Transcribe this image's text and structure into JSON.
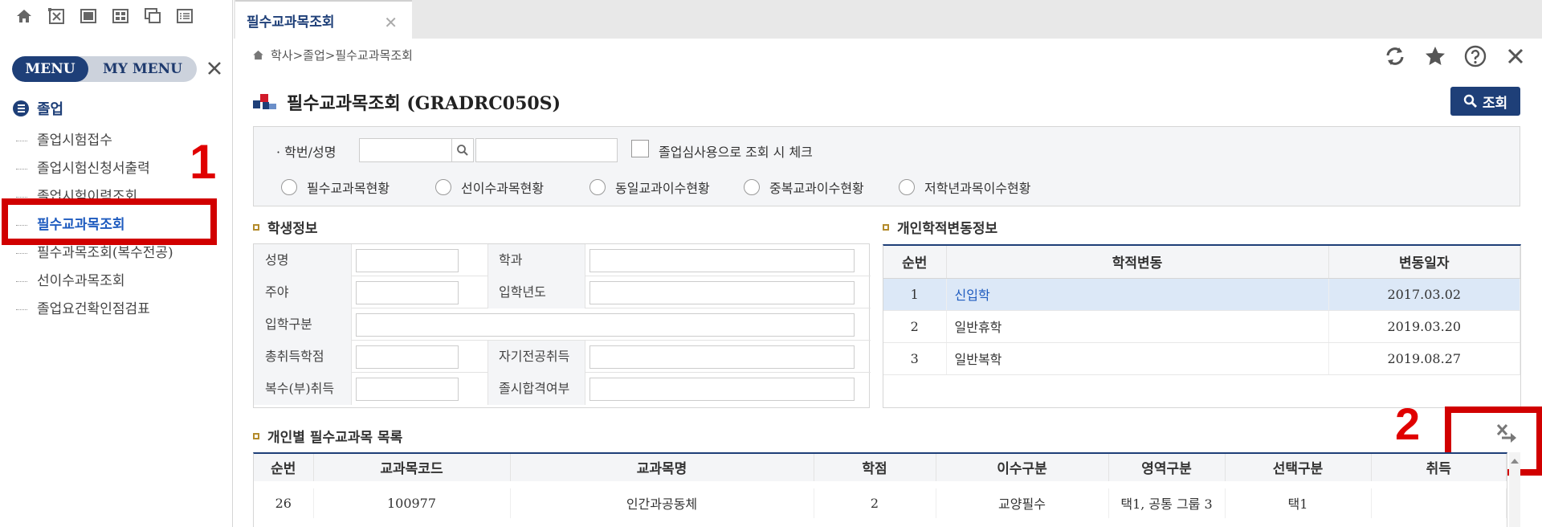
{
  "sidebar": {
    "toolbar_icons": [
      "home-icon",
      "close-window-icon",
      "window-icon",
      "grid-icon",
      "cascade-icon",
      "list-icon"
    ],
    "tabs": {
      "menu": "MENU",
      "my_menu": "MY MENU"
    },
    "section_title": "졸업",
    "items": [
      {
        "label": "졸업시험접수"
      },
      {
        "label": "졸업시험신청서출력"
      },
      {
        "label": "졸업시험이력조회"
      },
      {
        "label": "필수교과목조회",
        "active": true
      },
      {
        "label": "필수과목조회(복수전공)"
      },
      {
        "label": "선이수과목조회"
      },
      {
        "label": "졸업요건확인점검표"
      }
    ]
  },
  "annotations": {
    "label_1": "1",
    "label_2": "2",
    "color": "#d10000"
  },
  "tabbar": {
    "tab_label": "필수교과목조회",
    "close_glyph": "✕"
  },
  "breadcrumb": "학사>졸업>필수교과목조회",
  "util_icons": [
    "refresh-icon",
    "star-icon",
    "help-icon",
    "close-icon"
  ],
  "page": {
    "title": "필수교과목조회 (GRADRC050S)",
    "search_button": "조회"
  },
  "search": {
    "student_label": "· 학번/성명",
    "checkbox_label": "졸업심사용으로 조회 시 체크",
    "radios": [
      "필수교과목현황",
      "선이수과목현황",
      "동일교과이수현황",
      "중복교과이수현황",
      "저학년과목이수현황"
    ]
  },
  "student_info": {
    "title": "학생정보",
    "labels": {
      "name": "성명",
      "dept": "학과",
      "day_night": "주야",
      "entry_year": "입학년도",
      "entry_type": "입학구분",
      "total_credits": "총취득학점",
      "major_credits": "자기전공취득",
      "double_major": "복수(부)취득",
      "exam_pass": "졸시합격여부"
    }
  },
  "change_info": {
    "title": "개인학적변동정보",
    "headers": [
      "순번",
      "학적변동",
      "변동일자"
    ],
    "rows": [
      {
        "no": "1",
        "change": "신입학",
        "date": "2017.03.02"
      },
      {
        "no": "2",
        "change": "일반휴학",
        "date": "2019.03.20"
      },
      {
        "no": "3",
        "change": "일반복학",
        "date": "2019.08.27"
      }
    ]
  },
  "course_list": {
    "title": "개인별 필수교과목 목록",
    "headers": [
      "순번",
      "교과목코드",
      "교과목명",
      "학점",
      "이수구분",
      "영역구분",
      "선택구분",
      "취득"
    ],
    "rows": [
      {
        "no": "26",
        "code": "100977",
        "name": "인간과공동체",
        "credit": "2",
        "type": "교양필수",
        "area": "택1, 공통 그룹 3",
        "select": "택1",
        "earned": ""
      }
    ]
  },
  "colors": {
    "navy": "#1e3f78",
    "link_blue": "#1e5bbf",
    "selected_row": "#dce8f7",
    "bullet_gold": "#b38b2c"
  }
}
